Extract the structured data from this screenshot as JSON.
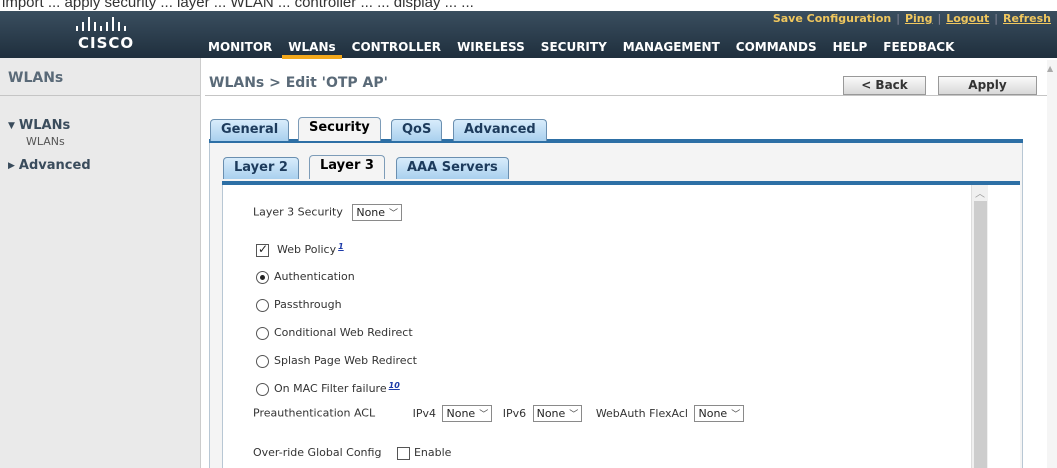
{
  "top_strip_text": "import ... apply security ... layer ... WLAN ... controller ... ... display ... ...",
  "header": {
    "logo_text": "CISCO",
    "util_links": [
      "Save Configuration",
      "Ping",
      "Logout",
      "Refresh"
    ],
    "menu": [
      {
        "label": "MONITOR",
        "active": false
      },
      {
        "label": "WLANs",
        "active": true
      },
      {
        "label": "CONTROLLER",
        "active": false
      },
      {
        "label": "WIRELESS",
        "active": false
      },
      {
        "label": "SECURITY",
        "active": false
      },
      {
        "label": "MANAGEMENT",
        "active": false
      },
      {
        "label": "COMMANDS",
        "active": false
      },
      {
        "label": "HELP",
        "active": false
      },
      {
        "label": "FEEDBACK",
        "active": false
      }
    ]
  },
  "sidebar": {
    "title": "WLANs",
    "items": [
      {
        "label": "WLANs",
        "expanded": true,
        "sub": "WLANs"
      },
      {
        "label": "Advanced",
        "expanded": false
      }
    ]
  },
  "main": {
    "title": "WLANs > Edit  'OTP AP'",
    "back_label": "< Back",
    "apply_label": "Apply",
    "tabs": [
      "General",
      "Security",
      "QoS",
      "Advanced"
    ],
    "active_tab": "Security",
    "subtabs": [
      "Layer 2",
      "Layer 3",
      "AAA Servers"
    ],
    "active_subtab": "Layer 3"
  },
  "form": {
    "layer3_security_label": "Layer 3 Security",
    "layer3_security_value": "None",
    "web_policy_label": "Web Policy",
    "web_policy_checked": true,
    "web_policy_note": "1",
    "radio_options": [
      {
        "label": "Authentication",
        "selected": true
      },
      {
        "label": "Passthrough",
        "selected": false
      },
      {
        "label": "Conditional Web Redirect",
        "selected": false
      },
      {
        "label": "Splash Page Web Redirect",
        "selected": false
      },
      {
        "label": "On MAC Filter failure",
        "selected": false,
        "note": "10"
      }
    ],
    "preauth_acl_label": "Preauthentication ACL",
    "ipv4_label": "IPv4",
    "ipv4_value": "None",
    "ipv6_label": "IPv6",
    "ipv6_value": "None",
    "webauth_label": "WebAuth FlexAcl",
    "webauth_value": "None",
    "override_label": "Over-ride Global Config",
    "override_checked": false,
    "override_enable_label": "Enable"
  }
}
